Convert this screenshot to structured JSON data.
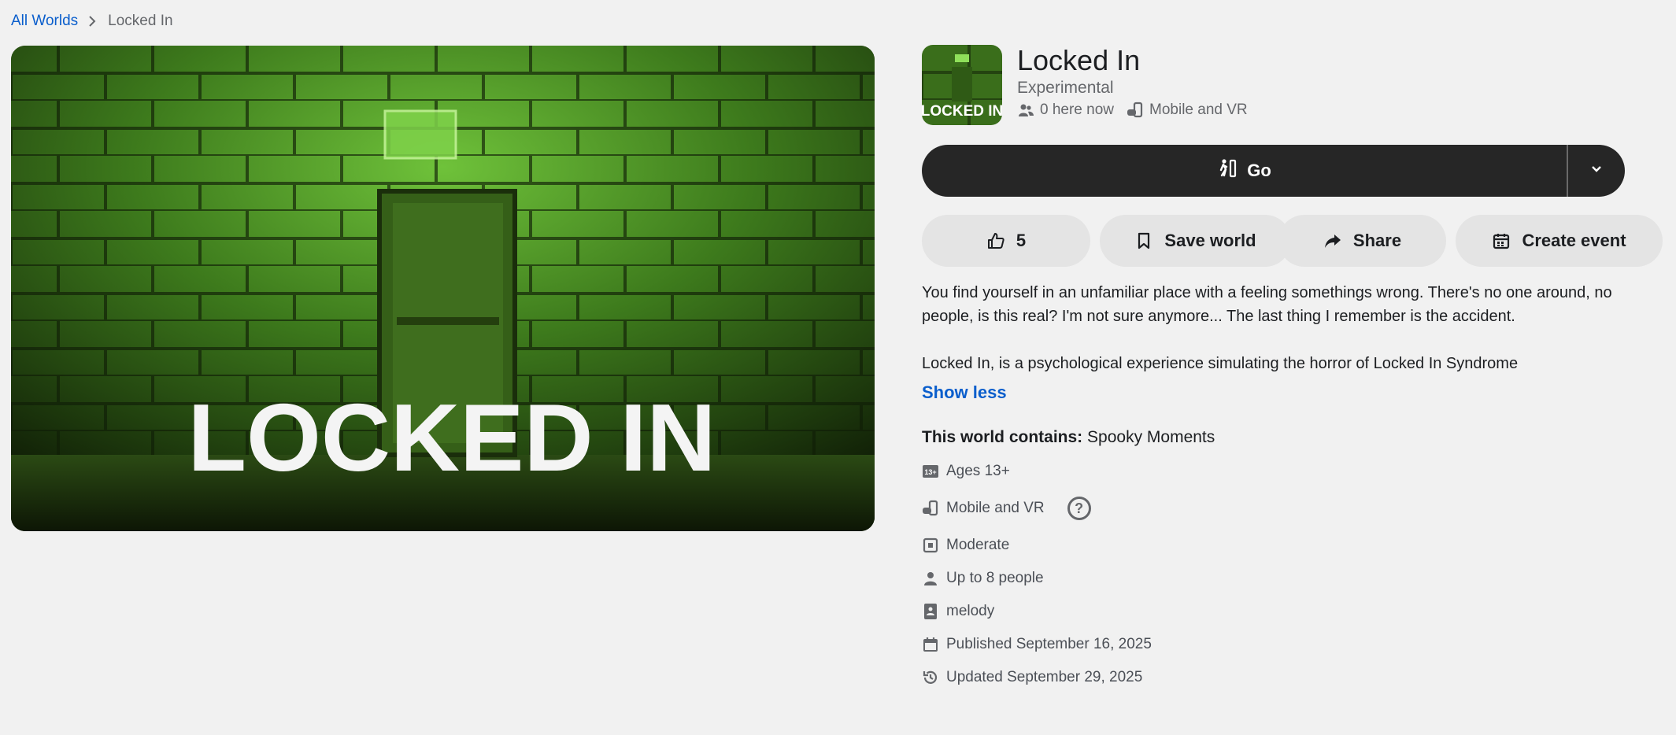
{
  "breadcrumb": {
    "root": "All Worlds",
    "current": "Locked In"
  },
  "hero": {
    "overlay_text": "LOCKED IN"
  },
  "thumbnail": {
    "text": "LOCKED IN"
  },
  "world": {
    "title": "Locked In",
    "category": "Experimental",
    "here_now": "0 here now",
    "platforms": "Mobile and VR"
  },
  "go": {
    "label": "Go"
  },
  "actions": {
    "likes": "5",
    "save": "Save world",
    "share": "Share",
    "create_event": "Create event"
  },
  "description": {
    "para1": "You find yourself in an unfamiliar place with a feeling somethings wrong. There's no one around, no people, is this real? I'm not sure anymore... The last thing I remember is the accident.",
    "para2": "Locked In, is a psychological experience simulating the horror of Locked In Syndrome",
    "toggle": "Show less"
  },
  "contains": {
    "label": "This world contains:",
    "value": "Spooky Moments"
  },
  "details": {
    "age_badge": "13+",
    "ages": "Ages 13+",
    "platforms": "Mobile and VR",
    "help": "?",
    "comfort": "Moderate",
    "capacity": "Up to 8 people",
    "creator": "melody",
    "published": "Published September 16, 2025",
    "updated": "Updated September 29, 2025"
  },
  "colors": {
    "link": "#0a5ecc",
    "go_button": "#262626",
    "pill": "#e4e4e4",
    "background": "#f1f1f1"
  }
}
